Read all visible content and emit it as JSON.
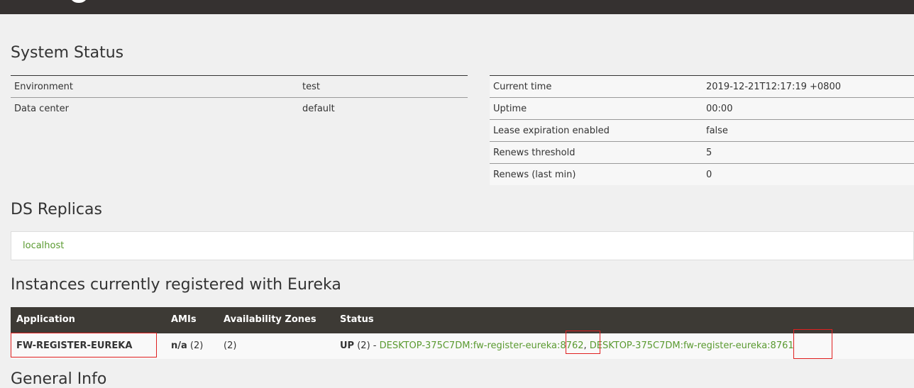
{
  "system_status": {
    "title": "System Status",
    "left": [
      {
        "label": "Environment",
        "value": "test"
      },
      {
        "label": "Data center",
        "value": "default"
      }
    ],
    "right": [
      {
        "label": "Current time",
        "value": "2019-12-21T12:17:19 +0800"
      },
      {
        "label": "Uptime",
        "value": "00:00"
      },
      {
        "label": "Lease expiration enabled",
        "value": "false"
      },
      {
        "label": "Renews threshold",
        "value": "5"
      },
      {
        "label": "Renews (last min)",
        "value": "0"
      }
    ]
  },
  "ds_replicas": {
    "title": "DS Replicas",
    "items": [
      "localhost"
    ]
  },
  "instances": {
    "title": "Instances currently registered with Eureka",
    "headers": [
      "Application",
      "AMIs",
      "Availability Zones",
      "Status"
    ],
    "rows": [
      {
        "application": "FW-REGISTER-EUREKA",
        "amis": "n/a",
        "amis_count": "(2)",
        "zones": "(2)",
        "status": "UP",
        "status_count": "(2) -",
        "links": [
          "DESKTOP-375C7DM:fw-register-eureka:8762",
          "DESKTOP-375C7DM:fw-register-eureka:8761"
        ]
      }
    ]
  },
  "general_info": {
    "title": "General Info"
  }
}
